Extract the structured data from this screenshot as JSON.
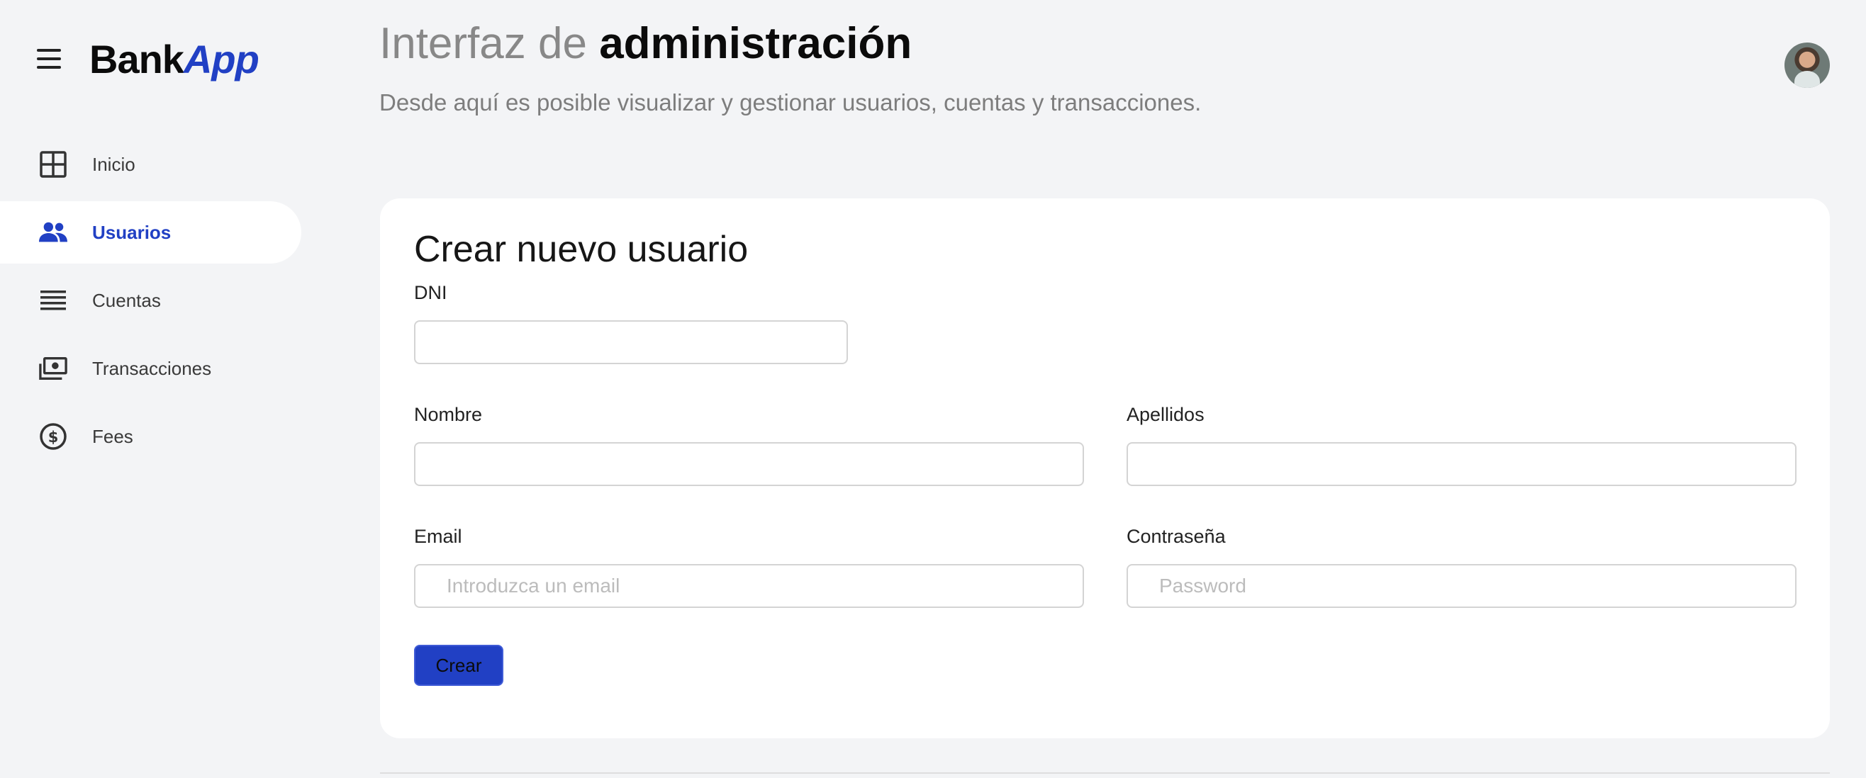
{
  "brand": {
    "part1": "Bank",
    "part2": "App",
    "accent_color": "#2140c4"
  },
  "sidebar": {
    "items": [
      {
        "label": "Inicio",
        "icon": "grid-icon",
        "active": false
      },
      {
        "label": "Usuarios",
        "icon": "users-icon",
        "active": true
      },
      {
        "label": "Cuentas",
        "icon": "list-icon",
        "active": false
      },
      {
        "label": "Transacciones",
        "icon": "money-icon",
        "active": false
      },
      {
        "label": "Fees",
        "icon": "dollar-circle-icon",
        "active": false
      }
    ]
  },
  "header": {
    "title_light": "Interfaz de",
    "title_bold": "administración",
    "subtitle": "Desde aquí es posible visualizar y gestionar usuarios, cuentas y transacciones."
  },
  "form": {
    "title": "Crear nuevo usuario",
    "dni": {
      "label": "DNI",
      "value": "",
      "placeholder": ""
    },
    "nombre": {
      "label": "Nombre",
      "value": "",
      "placeholder": ""
    },
    "apellidos": {
      "label": "Apellidos",
      "value": "",
      "placeholder": ""
    },
    "email": {
      "label": "Email",
      "value": "",
      "placeholder": "Introduzca un email"
    },
    "password": {
      "label": "Contraseña",
      "value": "",
      "placeholder": "Password"
    },
    "submit_label": "Crear"
  }
}
